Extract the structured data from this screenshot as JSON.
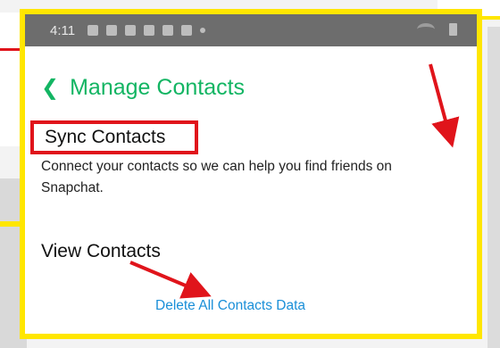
{
  "status_bar": {
    "time": "4:11"
  },
  "header": {
    "back_icon": "chevron-left-icon",
    "title": "Manage Contacts"
  },
  "sync_section": {
    "title": "Sync Contacts",
    "description": "Connect your contacts so we can help you find friends on Snapchat."
  },
  "view_section": {
    "title": "View Contacts"
  },
  "delete_link": {
    "label": "Delete All Contacts Data"
  },
  "colors": {
    "accent_green": "#13b563",
    "link_blue": "#1a8fd8",
    "highlight_red": "#e0141b",
    "frame_yellow": "#ffe600",
    "status_bar_gray": "#6d6d6d"
  }
}
